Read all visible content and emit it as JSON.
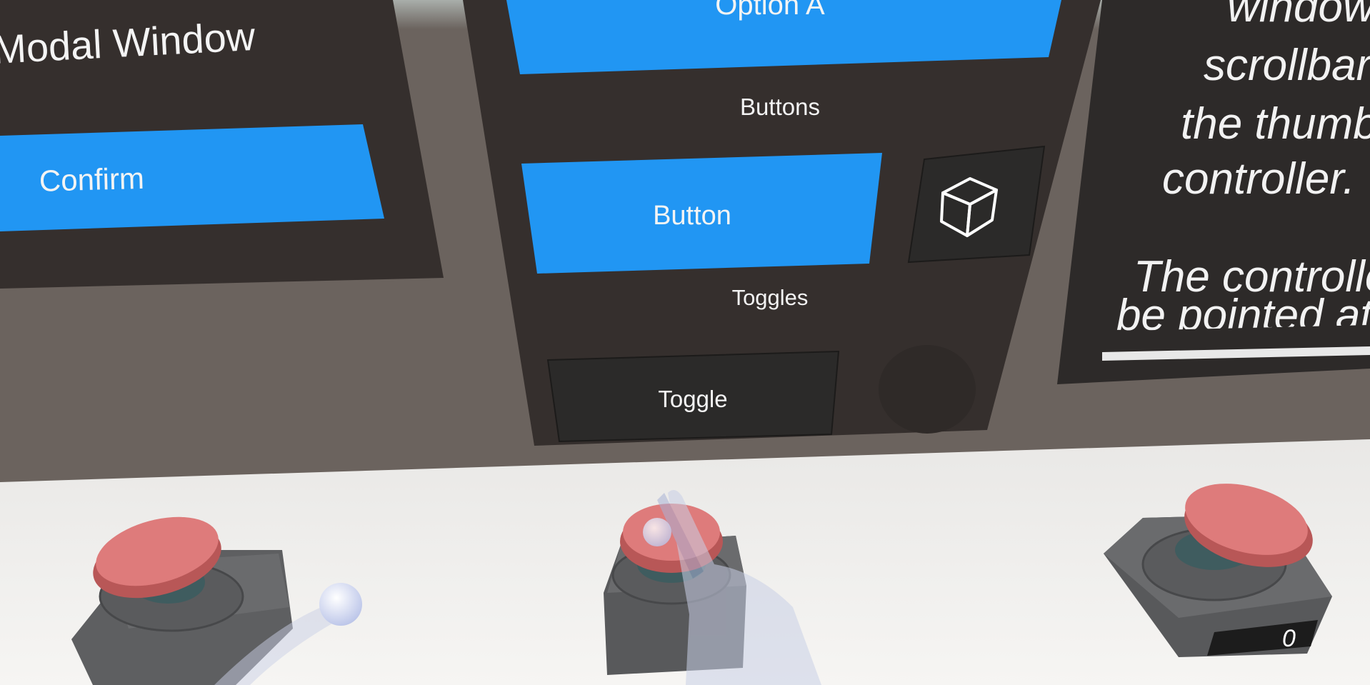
{
  "colors": {
    "wall": "#6b635e",
    "panel": "#352f2d",
    "accent_blue": "#2196f3",
    "toggle_bg": "#2b2a29",
    "floor": "#efeeec",
    "button_red": "#e07a7a"
  },
  "modal_panel": {
    "title": "Modal Window",
    "confirm_label": "Confirm"
  },
  "controls_panel": {
    "option_a_label": "Option A",
    "buttons_header": "Buttons",
    "button_label": "Button",
    "icon_button": "cube-icon",
    "toggles_header": "Toggles",
    "toggle_label": "Toggle"
  },
  "info_panel": {
    "lines": [
      "window",
      "scrollbar",
      "the thumb",
      "controller.",
      "The controller",
      "be pointed at t"
    ]
  },
  "physical_buttons": {
    "counter_value": "0"
  }
}
